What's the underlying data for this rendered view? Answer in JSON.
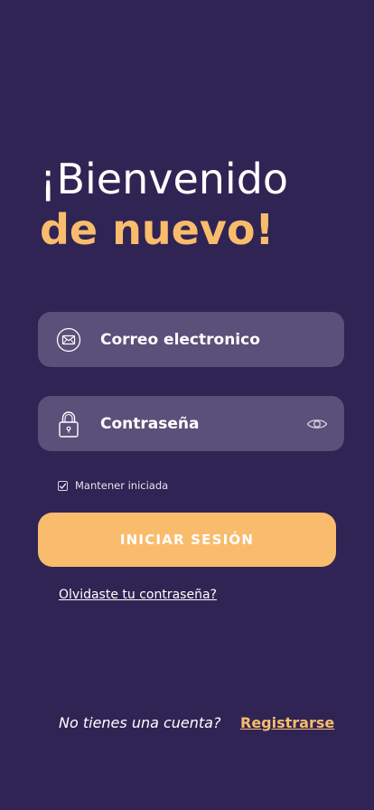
{
  "header": {
    "greeting_line1": "¡Bienvenido",
    "greeting_line2": "de nuevo!"
  },
  "form": {
    "email": {
      "placeholder": "Correo electronico",
      "value": "",
      "icon": "mail-icon"
    },
    "password": {
      "placeholder": "Contraseña",
      "value": "",
      "icon": "lock-icon",
      "toggle_icon": "eye-icon"
    },
    "remember_label": "Mantener iniciada",
    "remember_checked": true,
    "submit_label": "INICIAR SESIÓN",
    "forgot_label": "Olvidaste tu contraseña?"
  },
  "footer": {
    "prompt": "No tienes una cuenta?",
    "register_label": "Registrarse"
  },
  "colors": {
    "background": "#302454",
    "field": "#5b5079",
    "accent": "#f9bc6c"
  }
}
